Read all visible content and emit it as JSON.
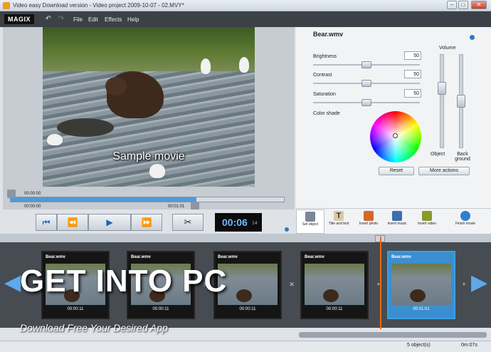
{
  "window": {
    "title": "Video easy Download version - Video project 2009-10-07 - 02.MVY*"
  },
  "menubar": {
    "logo": "MAGIX",
    "items": [
      "File",
      "Edit",
      "Effects",
      "Help"
    ]
  },
  "preview": {
    "caption": "Sample movie"
  },
  "timeline": {
    "tc_start_top": "00:00:00",
    "tc_start": "00:00:00",
    "tc_end": "00:01:01"
  },
  "transport": {
    "timecode": "00:06",
    "timecode_frames": "14"
  },
  "properties": {
    "object_name": "Bear.wmv",
    "brightness": {
      "label": "Brightness",
      "value": "50"
    },
    "contrast": {
      "label": "Contrast",
      "value": "50"
    },
    "saturation": {
      "label": "Saturation",
      "value": "50"
    },
    "color_shade_label": "Color shade",
    "volume_label": "Volume",
    "object_label": "Object",
    "background_label": "Back ground",
    "reset_label": "Reset",
    "more_actions_label": "More actions"
  },
  "tools": [
    {
      "label": "Set object"
    },
    {
      "label": "Title and text"
    },
    {
      "label": "Insert photo"
    },
    {
      "label": "Insert music"
    },
    {
      "label": "Insert video"
    },
    {
      "label": "Finish movie"
    }
  ],
  "storyboard": {
    "clips": [
      {
        "title": "Bear.wmv",
        "time": "00:00:11"
      },
      {
        "title": "Bear.wmv",
        "time": "00:00:11"
      },
      {
        "title": "Bear.wmv",
        "time": "00:00:11"
      },
      {
        "title": "Bear.wmv",
        "time": "00:00:11"
      },
      {
        "title": "Bear.wmv",
        "time": "00:01:01"
      }
    ]
  },
  "watermark": {
    "text": "GET INTO PC",
    "tagline": "Download Free Your Desired App"
  },
  "status": {
    "objects": "5 object(s)",
    "time": "0m:07s"
  },
  "colors": {
    "accent": "#3aa0e4",
    "playhead": "#ee6a12",
    "timecode": "#6fb6ff"
  }
}
